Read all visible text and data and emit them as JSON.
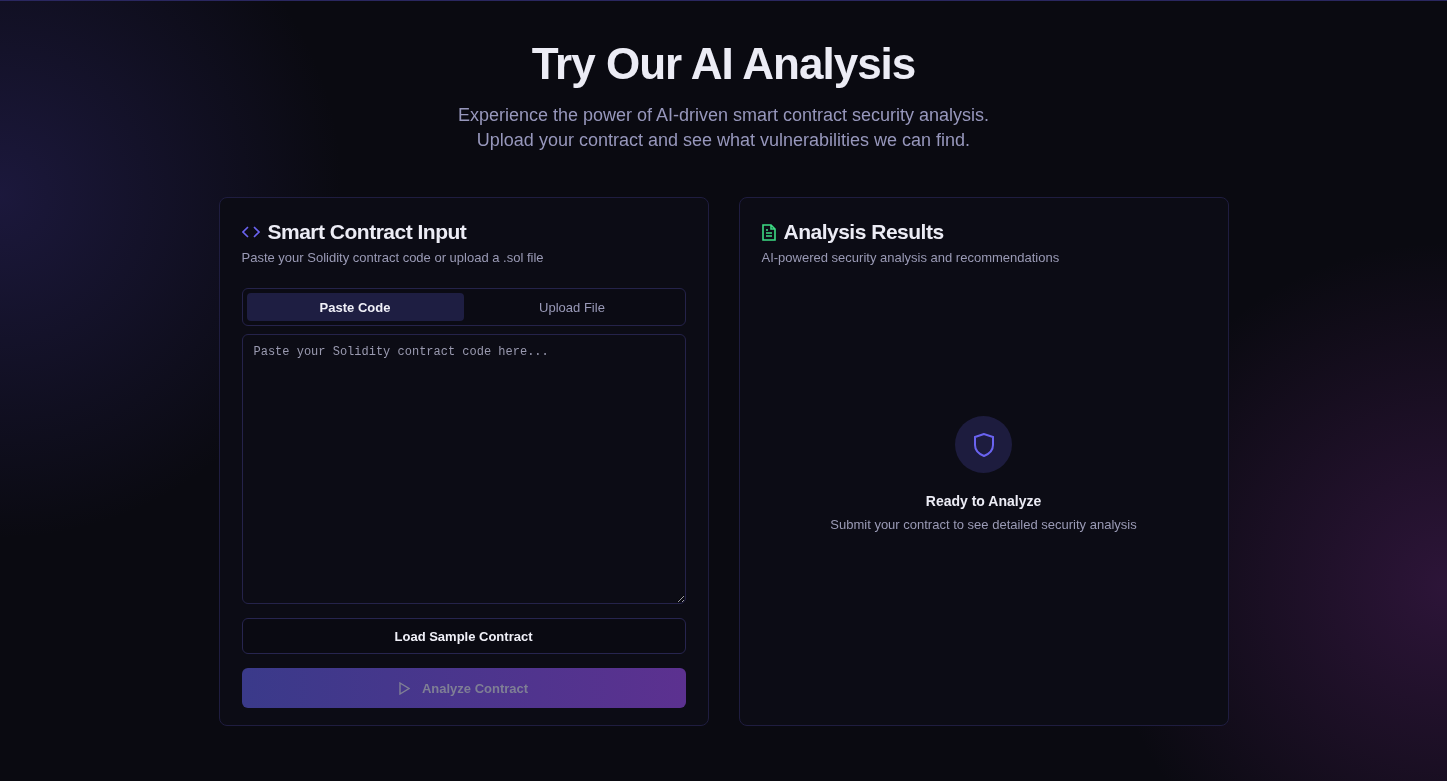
{
  "hero": {
    "title": "Try Our AI Analysis",
    "subtitle_lines": [
      "Experience the power of AI-driven smart contract security analysis.",
      "Upload your contract and see what vulnerabilities we can find."
    ]
  },
  "input_card": {
    "title": "Smart Contract Input",
    "description": "Paste your Solidity contract code or upload a .sol file",
    "tabs": [
      {
        "label": "Paste Code",
        "selected": true
      },
      {
        "label": "Upload File",
        "selected": false
      }
    ],
    "code_field": {
      "placeholder": "Paste your Solidity contract code here..."
    },
    "sample_button": {
      "label": "Load Sample Contract"
    },
    "analyze_button": {
      "label": "Analyze Contract",
      "disabled": true
    }
  },
  "results_card": {
    "title": "Analysis Results",
    "description": "AI-powered security analysis and recommendations",
    "empty_state": {
      "title": "Ready to Analyze",
      "message": "Submit your contract to see detailed security analysis"
    }
  }
}
